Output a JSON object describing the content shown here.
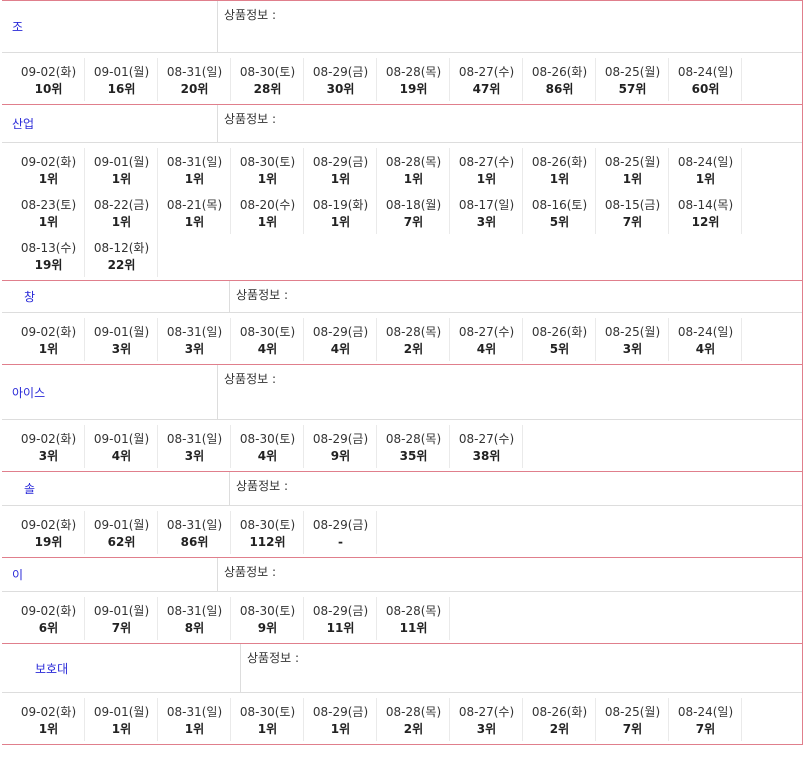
{
  "colors": {
    "border": "#e07f8c",
    "link": "#2a2ad8"
  },
  "products": [
    {
      "name": "조",
      "info_label": "상품정보 :",
      "ranks": [
        {
          "date": "09-02(화)",
          "rank": "10위"
        },
        {
          "date": "09-01(월)",
          "rank": "16위"
        },
        {
          "date": "08-31(일)",
          "rank": "20위"
        },
        {
          "date": "08-30(토)",
          "rank": "28위"
        },
        {
          "date": "08-29(금)",
          "rank": "30위"
        },
        {
          "date": "08-28(목)",
          "rank": "19위"
        },
        {
          "date": "08-27(수)",
          "rank": "47위"
        },
        {
          "date": "08-26(화)",
          "rank": "86위"
        },
        {
          "date": "08-25(월)",
          "rank": "57위"
        },
        {
          "date": "08-24(일)",
          "rank": "60위"
        }
      ]
    },
    {
      "name": "산업",
      "info_label": "상품정보 :",
      "ranks": [
        {
          "date": "09-02(화)",
          "rank": "1위"
        },
        {
          "date": "09-01(월)",
          "rank": "1위"
        },
        {
          "date": "08-31(일)",
          "rank": "1위"
        },
        {
          "date": "08-30(토)",
          "rank": "1위"
        },
        {
          "date": "08-29(금)",
          "rank": "1위"
        },
        {
          "date": "08-28(목)",
          "rank": "1위"
        },
        {
          "date": "08-27(수)",
          "rank": "1위"
        },
        {
          "date": "08-26(화)",
          "rank": "1위"
        },
        {
          "date": "08-25(월)",
          "rank": "1위"
        },
        {
          "date": "08-24(일)",
          "rank": "1위"
        },
        {
          "date": "08-23(토)",
          "rank": "1위"
        },
        {
          "date": "08-22(금)",
          "rank": "1위"
        },
        {
          "date": "08-21(목)",
          "rank": "1위"
        },
        {
          "date": "08-20(수)",
          "rank": "1위"
        },
        {
          "date": "08-19(화)",
          "rank": "1위"
        },
        {
          "date": "08-18(월)",
          "rank": "7위"
        },
        {
          "date": "08-17(일)",
          "rank": "3위"
        },
        {
          "date": "08-16(토)",
          "rank": "5위"
        },
        {
          "date": "08-15(금)",
          "rank": "7위"
        },
        {
          "date": "08-14(목)",
          "rank": "12위"
        },
        {
          "date": "08-13(수)",
          "rank": "19위"
        },
        {
          "date": "08-12(화)",
          "rank": "22위"
        }
      ]
    },
    {
      "name": "창",
      "info_label": "상품정보 :",
      "ranks": [
        {
          "date": "09-02(화)",
          "rank": "1위"
        },
        {
          "date": "09-01(월)",
          "rank": "3위"
        },
        {
          "date": "08-31(일)",
          "rank": "3위"
        },
        {
          "date": "08-30(토)",
          "rank": "4위"
        },
        {
          "date": "08-29(금)",
          "rank": "4위"
        },
        {
          "date": "08-28(목)",
          "rank": "2위"
        },
        {
          "date": "08-27(수)",
          "rank": "4위"
        },
        {
          "date": "08-26(화)",
          "rank": "5위"
        },
        {
          "date": "08-25(월)",
          "rank": "3위"
        },
        {
          "date": "08-24(일)",
          "rank": "4위"
        }
      ]
    },
    {
      "name": "아이스",
      "info_label": "상품정보 :",
      "ranks": [
        {
          "date": "09-02(화)",
          "rank": "3위"
        },
        {
          "date": "09-01(월)",
          "rank": "4위"
        },
        {
          "date": "08-31(일)",
          "rank": "3위"
        },
        {
          "date": "08-30(토)",
          "rank": "4위"
        },
        {
          "date": "08-29(금)",
          "rank": "9위"
        },
        {
          "date": "08-28(목)",
          "rank": "35위"
        },
        {
          "date": "08-27(수)",
          "rank": "38위"
        }
      ]
    },
    {
      "name": "솔",
      "info_label": "상품정보 :",
      "ranks": [
        {
          "date": "09-02(화)",
          "rank": "19위"
        },
        {
          "date": "09-01(월)",
          "rank": "62위"
        },
        {
          "date": "08-31(일)",
          "rank": "86위"
        },
        {
          "date": "08-30(토)",
          "rank": "112위"
        },
        {
          "date": "08-29(금)",
          "rank": "-"
        }
      ]
    },
    {
      "name": "이",
      "info_label": "상품정보 :",
      "ranks": [
        {
          "date": "09-02(화)",
          "rank": "6위"
        },
        {
          "date": "09-01(월)",
          "rank": "7위"
        },
        {
          "date": "08-31(일)",
          "rank": "8위"
        },
        {
          "date": "08-30(토)",
          "rank": "9위"
        },
        {
          "date": "08-29(금)",
          "rank": "11위"
        },
        {
          "date": "08-28(목)",
          "rank": "11위"
        }
      ]
    },
    {
      "name": "보호대",
      "info_label": "상품정보 :",
      "ranks": [
        {
          "date": "09-02(화)",
          "rank": "1위"
        },
        {
          "date": "09-01(월)",
          "rank": "1위"
        },
        {
          "date": "08-31(일)",
          "rank": "1위"
        },
        {
          "date": "08-30(토)",
          "rank": "1위"
        },
        {
          "date": "08-29(금)",
          "rank": "1위"
        },
        {
          "date": "08-28(목)",
          "rank": "2위"
        },
        {
          "date": "08-27(수)",
          "rank": "3위"
        },
        {
          "date": "08-26(화)",
          "rank": "2위"
        },
        {
          "date": "08-25(월)",
          "rank": "7위"
        },
        {
          "date": "08-24(일)",
          "rank": "7위"
        }
      ]
    }
  ]
}
